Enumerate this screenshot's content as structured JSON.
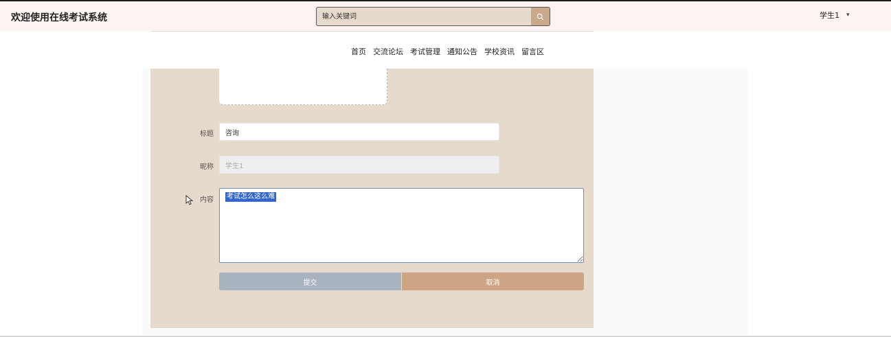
{
  "header": {
    "site_title": "欢迎使用在线考试系统",
    "search_placeholder": "输入关键词",
    "user_name": "学生1",
    "caret": "▾"
  },
  "nav": {
    "items": [
      "首页",
      "交流论坛",
      "考试管理",
      "通知公告",
      "学校资讯",
      "留言区"
    ]
  },
  "form": {
    "title_label": "标题",
    "title_value": "咨询",
    "nickname_label": "昵称",
    "nickname_value": "学生1",
    "content_label": "内容",
    "content_value": "考试怎么这么难",
    "submit_label": "提交",
    "cancel_label": "取消"
  },
  "icons": {
    "search": "search-icon",
    "cursor": "mouse-cursor-icon"
  }
}
